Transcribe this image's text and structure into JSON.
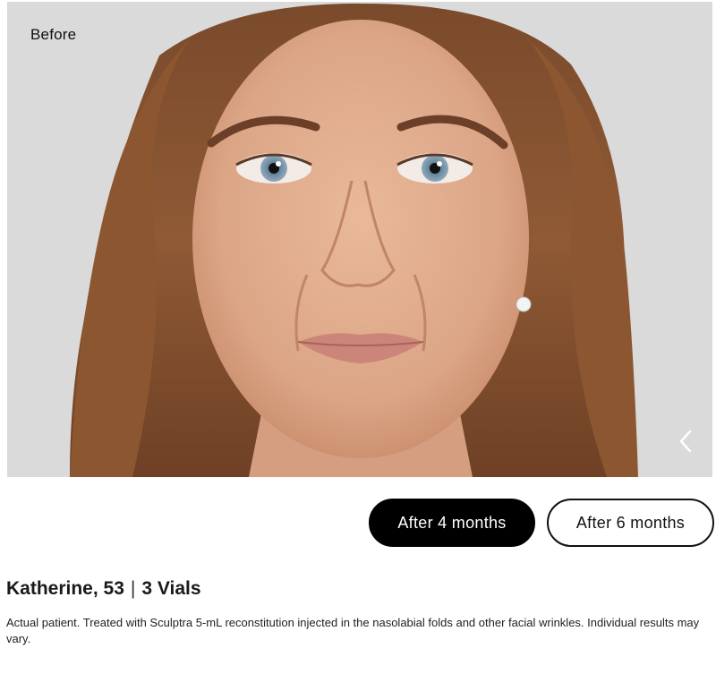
{
  "gallery": {
    "image_label": "Before",
    "image_alt": "Portrait of a woman with long wavy auburn hair",
    "next_icon": "chevron-left-icon"
  },
  "tabs": [
    {
      "label": "After 4 months",
      "active": true
    },
    {
      "label": "After 6 months",
      "active": false
    }
  ],
  "patient": {
    "name_age": "Katherine, 53",
    "separator": "|",
    "vials": "3 Vials"
  },
  "disclaimer": "Actual patient. Treated with Sculptra 5-mL reconstitution injected in the nasolabial folds and other facial wrinkles. Individual results may vary.",
  "colors": {
    "photo_background": "#d9dad9",
    "active_tab_bg": "#000000",
    "active_tab_text": "#ffffff"
  }
}
